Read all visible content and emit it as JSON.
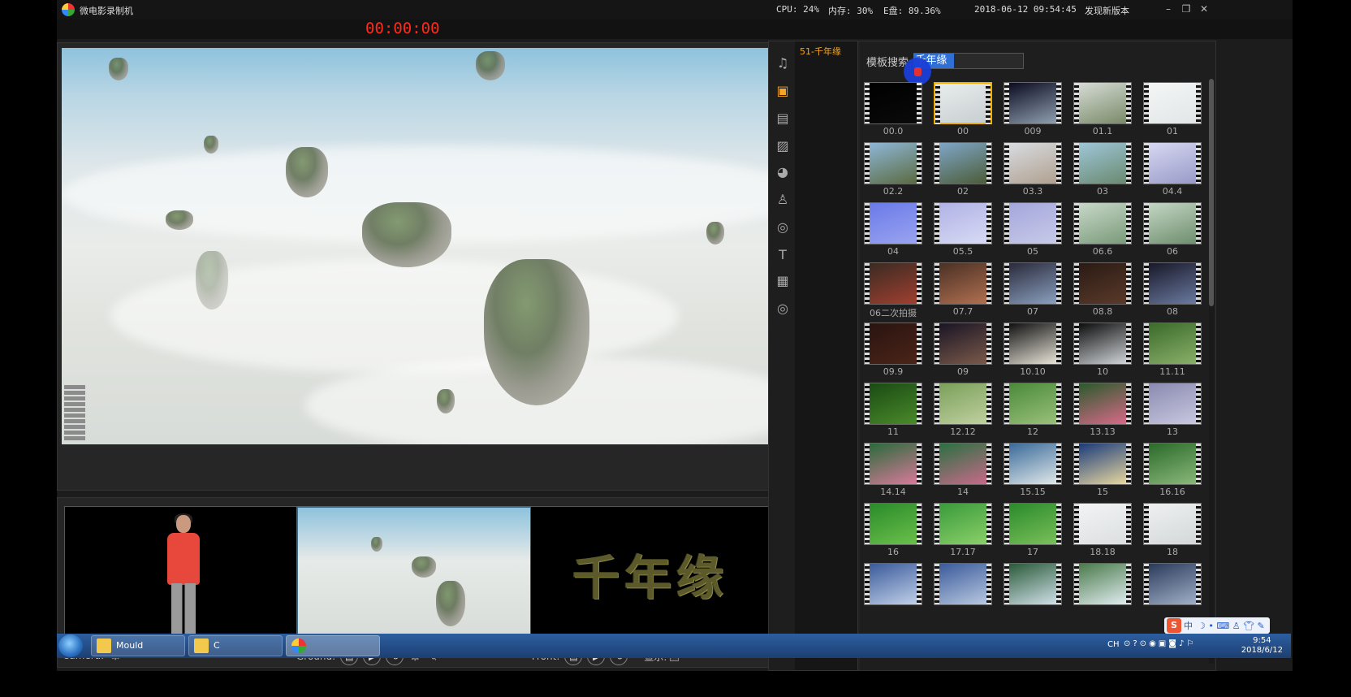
{
  "app": {
    "title": "微电影录制机",
    "update_link": "发现新版本"
  },
  "stats": {
    "cpu": "CPU: 24%",
    "mem": "内存: 30%",
    "disk": "E盘: 89.36%",
    "datetime": "2018-06-12 09:54:45"
  },
  "timer": "00:00:00",
  "preview_controls": [
    "record-circle",
    "play",
    "music",
    "camera",
    "people"
  ],
  "bottom": {
    "camera_label": "Camera:",
    "ground_label": "Ground:",
    "front_label": "Front:",
    "show_label": "显示:",
    "front_text": "千年缘"
  },
  "category": {
    "active": "51-千年缘"
  },
  "search": {
    "label": "模板搜索:",
    "value": "千年缘"
  },
  "templates": [
    {
      "label": "00.0",
      "c1": "#000000",
      "c2": "#0a0a0a"
    },
    {
      "label": "00",
      "c1": "#e8ecec",
      "c2": "#c8cfd2",
      "selected": true
    },
    {
      "label": "009",
      "c1": "#0b0b20",
      "c2": "#8fa0b0"
    },
    {
      "label": "01.1",
      "c1": "#d6dcd6",
      "c2": "#7a8a68"
    },
    {
      "label": "01",
      "c1": "#f4f6f6",
      "c2": "#e2e6e6"
    },
    {
      "label": "02.2",
      "c1": "#8fb7d8",
      "c2": "#5a6a40"
    },
    {
      "label": "02",
      "c1": "#7fa6c8",
      "c2": "#4c5c38"
    },
    {
      "label": "03.3",
      "c1": "#d8dce0",
      "c2": "#b0a090"
    },
    {
      "label": "03",
      "c1": "#9fc6d8",
      "c2": "#6a8a70"
    },
    {
      "label": "04.4",
      "c1": "#d6d8f2",
      "c2": "#9a9ac8"
    },
    {
      "label": "04",
      "c1": "#6a7ae8",
      "c2": "#9aa4f0"
    },
    {
      "label": "05.5",
      "c1": "#b0b2e6",
      "c2": "#d8daf4"
    },
    {
      "label": "05",
      "c1": "#a4a6dc",
      "c2": "#c8cae8"
    },
    {
      "label": "06.6",
      "c1": "#c8d8c8",
      "c2": "#7a9a7a"
    },
    {
      "label": "06",
      "c1": "#c4d6c4",
      "c2": "#6e8e6e"
    },
    {
      "label": "06二次拍摄",
      "c1": "#3a2a22",
      "c2": "#a04030"
    },
    {
      "label": "07.7",
      "c1": "#4a3024",
      "c2": "#b07050"
    },
    {
      "label": "07",
      "c1": "#2a2a3a",
      "c2": "#8aa0c0"
    },
    {
      "label": "08.8",
      "c1": "#2a1a14",
      "c2": "#5a3a2a"
    },
    {
      "label": "08",
      "c1": "#181828",
      "c2": "#6a7aa0"
    },
    {
      "label": "09.9",
      "c1": "#2a1410",
      "c2": "#4a2418"
    },
    {
      "label": "09",
      "c1": "#1a1424",
      "c2": "#7a5a4a"
    },
    {
      "label": "10.10",
      "c1": "#101010",
      "c2": "#e8e4d8"
    },
    {
      "label": "10",
      "c1": "#0c0c0c",
      "c2": "#d0d4d8"
    },
    {
      "label": "11.11",
      "c1": "#3a6a2a",
      "c2": "#8ab06a"
    },
    {
      "label": "11",
      "c1": "#1a4a14",
      "c2": "#4a8a2a"
    },
    {
      "label": "12.12",
      "c1": "#7aa05a",
      "c2": "#c0d0a0"
    },
    {
      "label": "12",
      "c1": "#4a8a3a",
      "c2": "#9ac07a"
    },
    {
      "label": "13.13",
      "c1": "#2a5a2a",
      "c2": "#d86a8a"
    },
    {
      "label": "13",
      "c1": "#8a8ab0",
      "c2": "#c8c8e0"
    },
    {
      "label": "14.14",
      "c1": "#2a6a3a",
      "c2": "#d87a9a"
    },
    {
      "label": "14",
      "c1": "#2a7040",
      "c2": "#c86a8a"
    },
    {
      "label": "15.15",
      "c1": "#3a6a9a",
      "c2": "#e0e8e8"
    },
    {
      "label": "15",
      "c1": "#1a3a7a",
      "c2": "#e8d8a0"
    },
    {
      "label": "16.16",
      "c1": "#2a6a2a",
      "c2": "#8ab87a"
    },
    {
      "label": "16",
      "c1": "#2a8a2a",
      "c2": "#6ac04a"
    },
    {
      "label": "17.17",
      "c1": "#3a9a3a",
      "c2": "#8ad06a"
    },
    {
      "label": "17",
      "c1": "#2a8a2a",
      "c2": "#7ac05a"
    },
    {
      "label": "18.18",
      "c1": "#f2f4f4",
      "c2": "#dcdfe0"
    },
    {
      "label": "18",
      "c1": "#eef0f0",
      "c2": "#d4d8da"
    },
    {
      "label": "",
      "c1": "#3a5a9a",
      "c2": "#c0d0e8"
    },
    {
      "label": "",
      "c1": "#3a5a9a",
      "c2": "#b8c8e0"
    },
    {
      "label": "",
      "c1": "#2a5a3a",
      "c2": "#d0e0e8"
    },
    {
      "label": "",
      "c1": "#4a7a4a",
      "c2": "#e0ecf0"
    },
    {
      "label": "",
      "c1": "#2a3a5a",
      "c2": "#a0b0c8"
    }
  ],
  "taskbar": {
    "items": [
      "Mould",
      "C",
      ""
    ],
    "lang": "CH",
    "time": "9:54",
    "date": "2018/6/12"
  },
  "ime": {
    "label": "中"
  },
  "colors": {
    "accent": "#f6a623",
    "timer": "#ff2a1a",
    "selection": "#2f6fd6"
  }
}
